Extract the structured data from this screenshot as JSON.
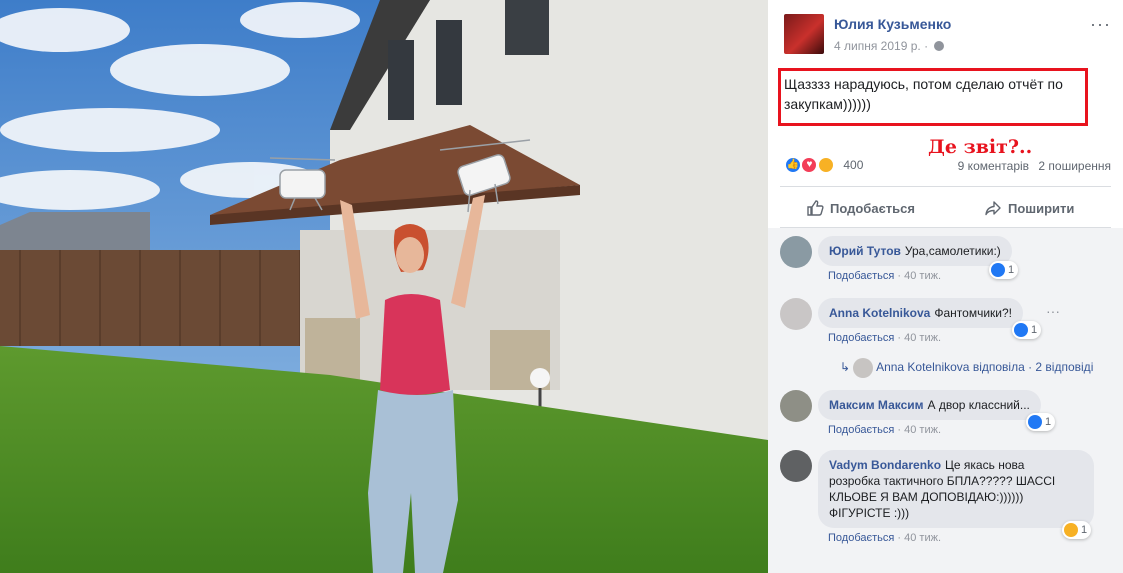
{
  "post": {
    "author": "Юлия Кузьменко",
    "date": "4 липня 2019 р.",
    "text": "Щазззз нарадуюсь, потом сделаю отчёт по закупкам))))))",
    "annotation": "Де звіт?..",
    "reaction_count": "400",
    "comments_count": "9 коментарів",
    "shares_count": "2 поширення",
    "like_label": "Подобається",
    "share_label": "Поширити",
    "more_icon": "more-icon",
    "colors": {
      "highlight": "#e8131e",
      "link": "#385898",
      "like": "#2078f4"
    }
  },
  "comments": [
    {
      "name": "Юрий Тутов",
      "text": "Ура,самолетики:)",
      "like_label": "Подобається",
      "age": "40 тиж.",
      "reactions": "1",
      "reaction_type": "like"
    },
    {
      "name": "Anna Kotelnikova",
      "text": "Фантомчики?!",
      "like_label": "Подобається",
      "age": "40 тиж.",
      "reactions": "1",
      "reaction_type": "like"
    },
    {
      "name": "Максим Максим",
      "text": "А двор классний...",
      "like_label": "Подобається",
      "age": "40 тиж.",
      "reactions": "1",
      "reaction_type": "like"
    },
    {
      "name": "Vadym Bondarenko",
      "text_lines": [
        "Це якась нова",
        "розробка тактичного БПЛА????? ШАССІ",
        "КЛЬОВЕ Я ВАМ ДОПОВІДАЮ:))))))",
        "ФІГУРІСТЕ :)))"
      ],
      "like_label": "Подобається",
      "age": "40 тиж.",
      "reactions": "1",
      "reaction_type": "haha"
    }
  ],
  "reply": {
    "author": "Anna Kotelnikova",
    "action": "відповіла",
    "count": "2 відповіді"
  }
}
